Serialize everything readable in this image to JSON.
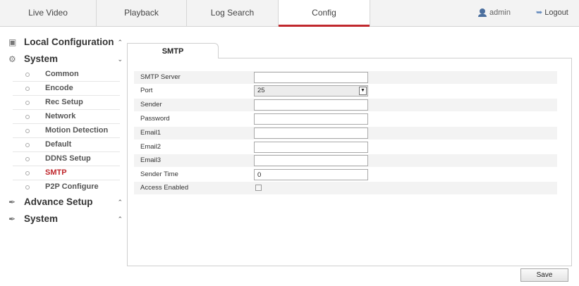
{
  "nav": {
    "tabs": [
      {
        "label": "Live Video"
      },
      {
        "label": "Playback"
      },
      {
        "label": "Log Search"
      },
      {
        "label": "Config"
      }
    ],
    "user": "admin",
    "logout": "Logout",
    "accent": "#c0282d"
  },
  "sidebar": {
    "local_config": "Local Configuration",
    "system": "System",
    "items": [
      {
        "label": "Common"
      },
      {
        "label": "Encode"
      },
      {
        "label": "Rec Setup"
      },
      {
        "label": "Network"
      },
      {
        "label": "Motion Detection"
      },
      {
        "label": "Default"
      },
      {
        "label": "DDNS Setup"
      },
      {
        "label": "SMTP"
      },
      {
        "label": "P2P Configure"
      }
    ],
    "advance_setup": "Advance Setup",
    "system2": "System"
  },
  "main": {
    "tab": "SMTP",
    "fields": {
      "smtp_server": {
        "label": "SMTP Server",
        "value": ""
      },
      "port": {
        "label": "Port",
        "value": "25"
      },
      "sender": {
        "label": "Sender",
        "value": ""
      },
      "password": {
        "label": "Password",
        "value": ""
      },
      "email1": {
        "label": "Email1",
        "value": ""
      },
      "email2": {
        "label": "Email2",
        "value": ""
      },
      "email3": {
        "label": "Email3",
        "value": ""
      },
      "sender_time": {
        "label": "Sender Time",
        "value": "0"
      },
      "access_enabled": {
        "label": "Access Enabled",
        "checked": false
      }
    },
    "save": "Save"
  }
}
